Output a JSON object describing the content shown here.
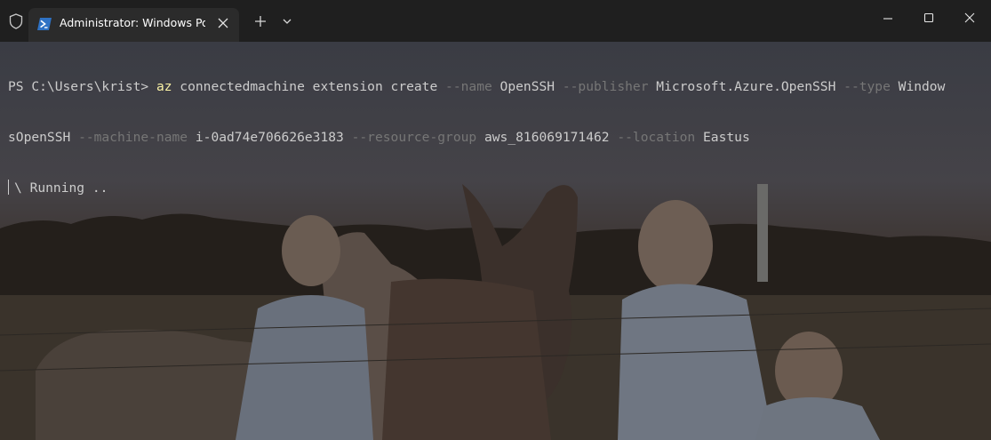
{
  "titlebar": {
    "tab_title": "Administrator: Windows PowerShell",
    "icons": {
      "shield": "shield-icon",
      "tab": "powershell-icon",
      "tab_close": "close-icon",
      "new_tab": "plus-icon",
      "dropdown": "chevron-down-icon",
      "minimize": "minimize-icon",
      "maximize": "maximize-icon",
      "close": "close-icon"
    }
  },
  "terminal": {
    "line1": {
      "prompt": "PS C:\\Users\\krist> ",
      "az": "az",
      "t1": " connectedmachine extension create ",
      "f_name": "--name",
      "v_name": " OpenSSH ",
      "f_publisher": "--publisher",
      "v_publisher": " Microsoft.Azure.OpenSSH ",
      "f_type": "--type",
      "v_type_part1": " Window"
    },
    "line2": {
      "v_type_part2": "sOpenSSH ",
      "f_machine": "--machine-name",
      "v_machine": " i-0ad74e706626e3183 ",
      "f_rg": "--resource-group",
      "v_rg": " aws_816069171462 ",
      "f_location": "--location",
      "v_location": " Eastus"
    },
    "line3": {
      "status": "\\ Running .."
    }
  },
  "colors": {
    "titlebar_bg": "#1f1f1f",
    "tab_bg": "#2b2b2b",
    "text": "#cccccc",
    "command_highlight": "#f9f1a5",
    "parameter_gray": "#767676"
  }
}
